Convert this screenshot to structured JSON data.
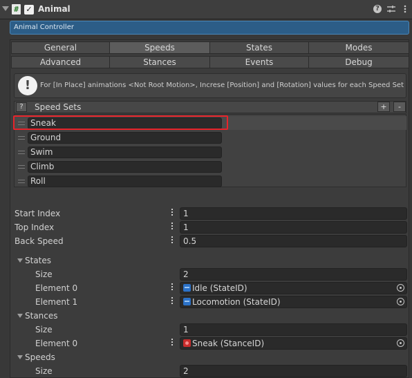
{
  "component": {
    "title": "Animal",
    "script_icon": "#",
    "enabled_mark": "✓",
    "help_glyph": "?",
    "icons": [
      "help-icon",
      "settings-sliders-icon",
      "kebab-menu-icon"
    ]
  },
  "banner": {
    "label": "Animal Controller"
  },
  "tabs": {
    "row1": [
      {
        "label": "General"
      },
      {
        "label": "Speeds"
      },
      {
        "label": "States"
      },
      {
        "label": "Modes"
      }
    ],
    "row2": [
      {
        "label": "Advanced"
      },
      {
        "label": "Stances"
      },
      {
        "label": "Events"
      },
      {
        "label": "Debug"
      }
    ],
    "active": "Speeds"
  },
  "helpbox": {
    "glyph": "!",
    "text": "For [In Place] animations <Not Root Motion>, Increse [Position] and [Rotation] values for each Speed Set"
  },
  "speed_sets": {
    "help_glyph": "?",
    "title": "Speed Sets",
    "add_label": "+",
    "remove_label": "-",
    "items": [
      "Sneak",
      "Ground",
      "Swim",
      "Climb",
      "Roll"
    ],
    "selected": "Sneak"
  },
  "props": {
    "start_index": {
      "label": "Start Index",
      "value": "1"
    },
    "top_index": {
      "label": "Top Index",
      "value": "1"
    },
    "back_speed": {
      "label": "Back Speed",
      "value": "0.5"
    }
  },
  "states": {
    "label": "States",
    "size_label": "Size",
    "size": "2",
    "elements": [
      {
        "label": "Element 0",
        "value": "Idle (StateID)"
      },
      {
        "label": "Element 1",
        "value": "Locomotion (StateID)"
      }
    ]
  },
  "stances": {
    "label": "Stances",
    "size_label": "Size",
    "size": "1",
    "elements": [
      {
        "label": "Element 0",
        "value": "Sneak (StanceID)"
      }
    ]
  },
  "speeds": {
    "label": "Speeds",
    "size_label": "Size",
    "size": "2"
  },
  "colors": {
    "background": "#383838",
    "banner": "#2c5d87",
    "selection_outline": "#e8232a",
    "state_icon": "#2c72c8",
    "stance_icon": "#c82c2c"
  }
}
